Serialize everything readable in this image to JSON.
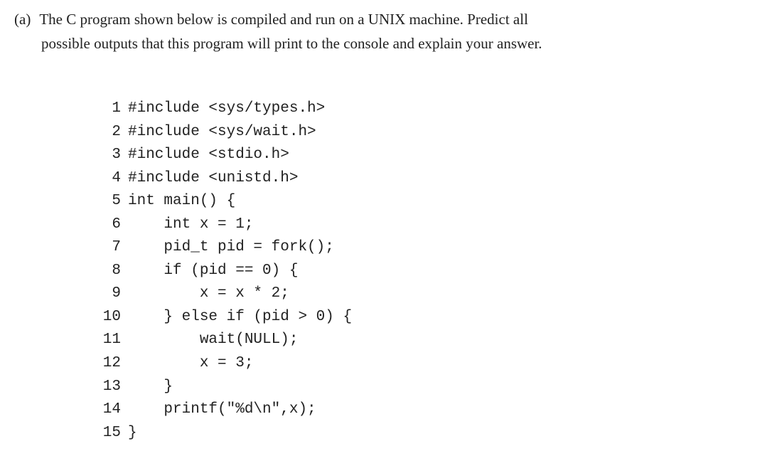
{
  "question": {
    "label": "(a)",
    "line1": "The C program shown below is compiled and run on a UNIX machine.  Predict all",
    "line2": "possible outputs that this program will print to the console and explain your answer."
  },
  "code": {
    "lines": [
      {
        "num": "1",
        "text": "#include <sys/types.h>"
      },
      {
        "num": "2",
        "text": "#include <sys/wait.h>"
      },
      {
        "num": "3",
        "text": "#include <stdio.h>"
      },
      {
        "num": "4",
        "text": "#include <unistd.h>"
      },
      {
        "num": "5",
        "text": "int main() {"
      },
      {
        "num": "6",
        "text": "    int x = 1;"
      },
      {
        "num": "7",
        "text": "    pid_t pid = fork();"
      },
      {
        "num": "8",
        "text": "    if (pid == 0) {"
      },
      {
        "num": "9",
        "text": "        x = x * 2;"
      },
      {
        "num": "10",
        "text": "    } else if (pid > 0) {"
      },
      {
        "num": "11",
        "text": "        wait(NULL);"
      },
      {
        "num": "12",
        "text": "        x = 3;"
      },
      {
        "num": "13",
        "text": "    }"
      },
      {
        "num": "14",
        "text": "    printf(\"%d\\n\",x);"
      },
      {
        "num": "15",
        "text": "}"
      }
    ]
  }
}
